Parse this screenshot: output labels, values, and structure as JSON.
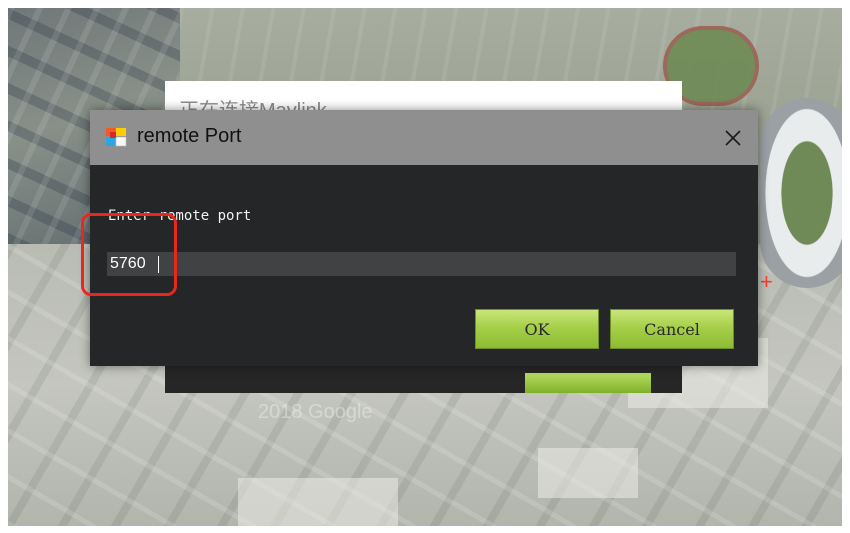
{
  "background_window": {
    "title": "正在连接Mavlink"
  },
  "map": {
    "watermark": "2018 Google"
  },
  "dialog": {
    "title": "remote Port",
    "prompt": "Enter remote port",
    "port_value": "5760",
    "ok_label": "OK",
    "cancel_label": "Cancel"
  },
  "icons": {
    "app": "app-icon",
    "close": "close-icon"
  },
  "colors": {
    "button_green": "#a7cf4a",
    "highlight_red": "#e8281f",
    "dialog_bg": "#252627",
    "titlebar": "#8f8f8f"
  }
}
